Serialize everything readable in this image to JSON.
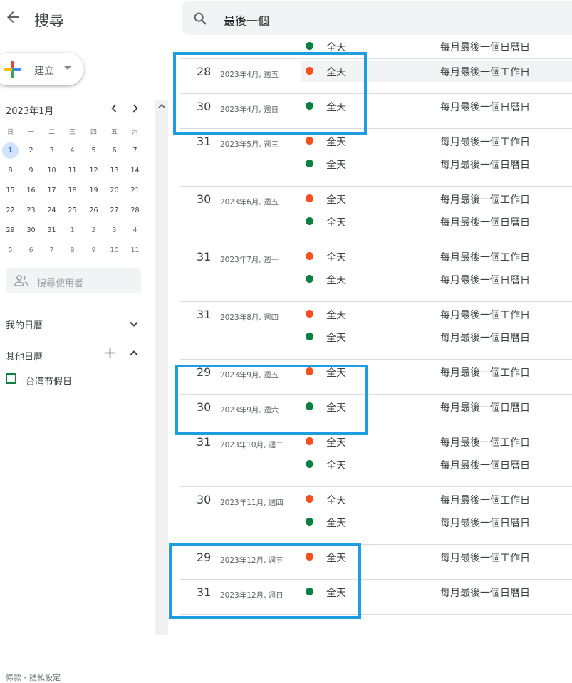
{
  "header": {
    "title": "搜尋",
    "search_value": "最後一個"
  },
  "sidebar": {
    "create_label": "建立",
    "mini_month": "2023年1月",
    "weekdays": [
      "日",
      "一",
      "二",
      "三",
      "四",
      "五",
      "六"
    ],
    "weeks": [
      [
        "1",
        "2",
        "3",
        "4",
        "5",
        "6",
        "7"
      ],
      [
        "8",
        "9",
        "10",
        "11",
        "12",
        "13",
        "14"
      ],
      [
        "15",
        "16",
        "17",
        "18",
        "19",
        "20",
        "21"
      ],
      [
        "22",
        "23",
        "24",
        "25",
        "26",
        "27",
        "28"
      ],
      [
        "29",
        "30",
        "31",
        "1",
        "2",
        "3",
        "4"
      ],
      [
        "5",
        "6",
        "7",
        "8",
        "9",
        "10",
        "11"
      ]
    ],
    "search_people_placeholder": "搜尋使用者",
    "my_calendars": "我的日曆",
    "other_calendars": "其他日曆",
    "calendar_item": "台湾节假日",
    "footer": "條款・隱私設定"
  },
  "colors": {
    "orange": "#f4511e",
    "green": "#0b8043",
    "highlight": "#1e9de0"
  },
  "events": {
    "top_partial": {
      "time": "全天",
      "title": "每月最後一個日曆日"
    },
    "groups": [
      {
        "date": "28",
        "meta": "2023年4月, 週五",
        "items": [
          {
            "color": "orange",
            "time": "全天",
            "title": "每月最後一個工作日"
          }
        ]
      },
      {
        "date": "30",
        "meta": "2023年4月, 週日",
        "items": [
          {
            "color": "green",
            "time": "全天",
            "title": "每月最後一個日曆日"
          }
        ]
      },
      {
        "date": "31",
        "meta": "2023年5月, 週三",
        "items": [
          {
            "color": "orange",
            "time": "全天",
            "title": "每月最後一個工作日"
          },
          {
            "color": "green",
            "time": "全天",
            "title": "每月最後一個日曆日"
          }
        ]
      },
      {
        "date": "30",
        "meta": "2023年6月, 週五",
        "items": [
          {
            "color": "orange",
            "time": "全天",
            "title": "每月最後一個工作日"
          },
          {
            "color": "green",
            "time": "全天",
            "title": "每月最後一個日曆日"
          }
        ]
      },
      {
        "date": "31",
        "meta": "2023年7月, 週一",
        "items": [
          {
            "color": "orange",
            "time": "全天",
            "title": "每月最後一個工作日"
          },
          {
            "color": "green",
            "time": "全天",
            "title": "每月最後一個日曆日"
          }
        ]
      },
      {
        "date": "31",
        "meta": "2023年8月, 週四",
        "items": [
          {
            "color": "orange",
            "time": "全天",
            "title": "每月最後一個工作日"
          },
          {
            "color": "green",
            "time": "全天",
            "title": "每月最後一個日曆日"
          }
        ]
      },
      {
        "date": "29",
        "meta": "2023年9月, 週五",
        "items": [
          {
            "color": "orange",
            "time": "全天",
            "title": "每月最後一個工作日"
          }
        ]
      },
      {
        "date": "30",
        "meta": "2023年9月, 週六",
        "items": [
          {
            "color": "green",
            "time": "全天",
            "title": "每月最後一個日曆日"
          }
        ]
      },
      {
        "date": "31",
        "meta": "2023年10月, 週二",
        "items": [
          {
            "color": "orange",
            "time": "全天",
            "title": "每月最後一個工作日"
          },
          {
            "color": "green",
            "time": "全天",
            "title": "每月最後一個日曆日"
          }
        ]
      },
      {
        "date": "30",
        "meta": "2023年11月, 週四",
        "items": [
          {
            "color": "orange",
            "time": "全天",
            "title": "每月最後一個工作日"
          },
          {
            "color": "green",
            "time": "全天",
            "title": "每月最後一個日曆日"
          }
        ]
      },
      {
        "date": "29",
        "meta": "2023年12月, 週五",
        "items": [
          {
            "color": "orange",
            "time": "全天",
            "title": "每月最後一個工作日"
          }
        ]
      },
      {
        "date": "31",
        "meta": "2023年12月, 週日",
        "items": [
          {
            "color": "green",
            "time": "全天",
            "title": "每月最後一個日曆日"
          }
        ]
      }
    ]
  }
}
